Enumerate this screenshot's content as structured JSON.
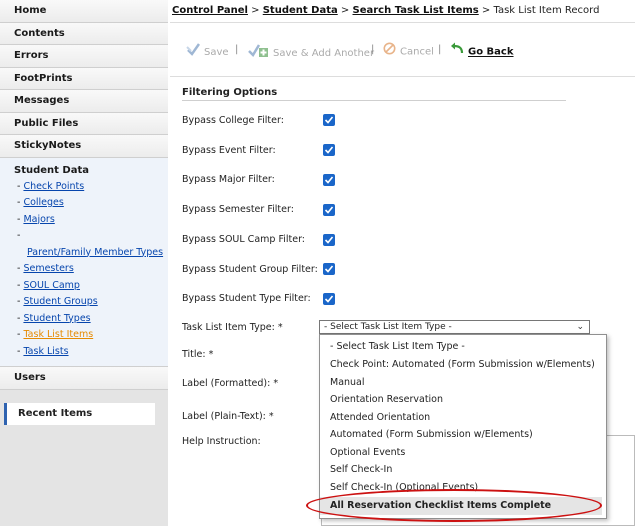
{
  "sidebar": {
    "top_items": [
      {
        "label": "Home"
      },
      {
        "label": "Contents"
      },
      {
        "label": "Errors"
      },
      {
        "label": "FootPrints"
      },
      {
        "label": "Messages"
      },
      {
        "label": "Public Files"
      },
      {
        "label": "StickyNotes"
      }
    ],
    "student_data": {
      "title": "Student Data",
      "items": [
        {
          "label": "Check Points"
        },
        {
          "label": "Colleges"
        },
        {
          "label": "Majors"
        },
        {
          "label": "Parent/Family Member Types"
        },
        {
          "label": "Semesters"
        },
        {
          "label": "SOUL Camp"
        },
        {
          "label": "Student Groups"
        },
        {
          "label": "Student Types"
        },
        {
          "label": "Task List Items"
        },
        {
          "label": "Task Lists"
        }
      ]
    },
    "users_label": "Users",
    "recent_items_label": "Recent Items"
  },
  "breadcrumb": {
    "control_panel": "Control Panel",
    "student_data": "Student Data",
    "search_task_list_items": "Search Task List Items",
    "current": "Task List Item Record",
    "separator": ">"
  },
  "toolbar": {
    "save": "Save",
    "save_add_another": "Save & Add Another",
    "cancel": "Cancel",
    "go_back": "Go Back",
    "separator": "|"
  },
  "form": {
    "section_title": "Filtering Options",
    "bypass_college": "Bypass College Filter:",
    "bypass_event": "Bypass Event Filter:",
    "bypass_major": "Bypass Major Filter:",
    "bypass_semester": "Bypass Semester Filter:",
    "bypass_soul_camp": "Bypass SOUL Camp Filter:",
    "bypass_student_group": "Bypass Student Group Filter:",
    "bypass_student_type": "Bypass Student Type Filter:",
    "task_list_item_type": "Task List Item Type: *",
    "title": "Title: *",
    "label_formatted": "Label (Formatted): *",
    "label_plain": "Label (Plain-Text): *",
    "help_instruction": "Help Instruction:"
  },
  "select": {
    "value": "- Select Task List Item Type -",
    "chevron": "⌄",
    "options": [
      {
        "label": "- Select Task List Item Type -"
      },
      {
        "label": "Check Point: Automated (Form Submission w/Elements)"
      },
      {
        "label": "Manual"
      },
      {
        "label": "Orientation Reservation"
      },
      {
        "label": "Attended Orientation"
      },
      {
        "label": "Automated (Form Submission w/Elements)"
      },
      {
        "label": "Optional Events"
      },
      {
        "label": "Self Check-In"
      },
      {
        "label": "Self Check-In (Optional Events)"
      },
      {
        "label": "All Reservation Checklist Items Complete"
      }
    ]
  },
  "colors": {
    "link": "#0645ad",
    "active_link": "#e68a00",
    "checkbox": "#1a66c9",
    "annotation": "#cc1111"
  }
}
